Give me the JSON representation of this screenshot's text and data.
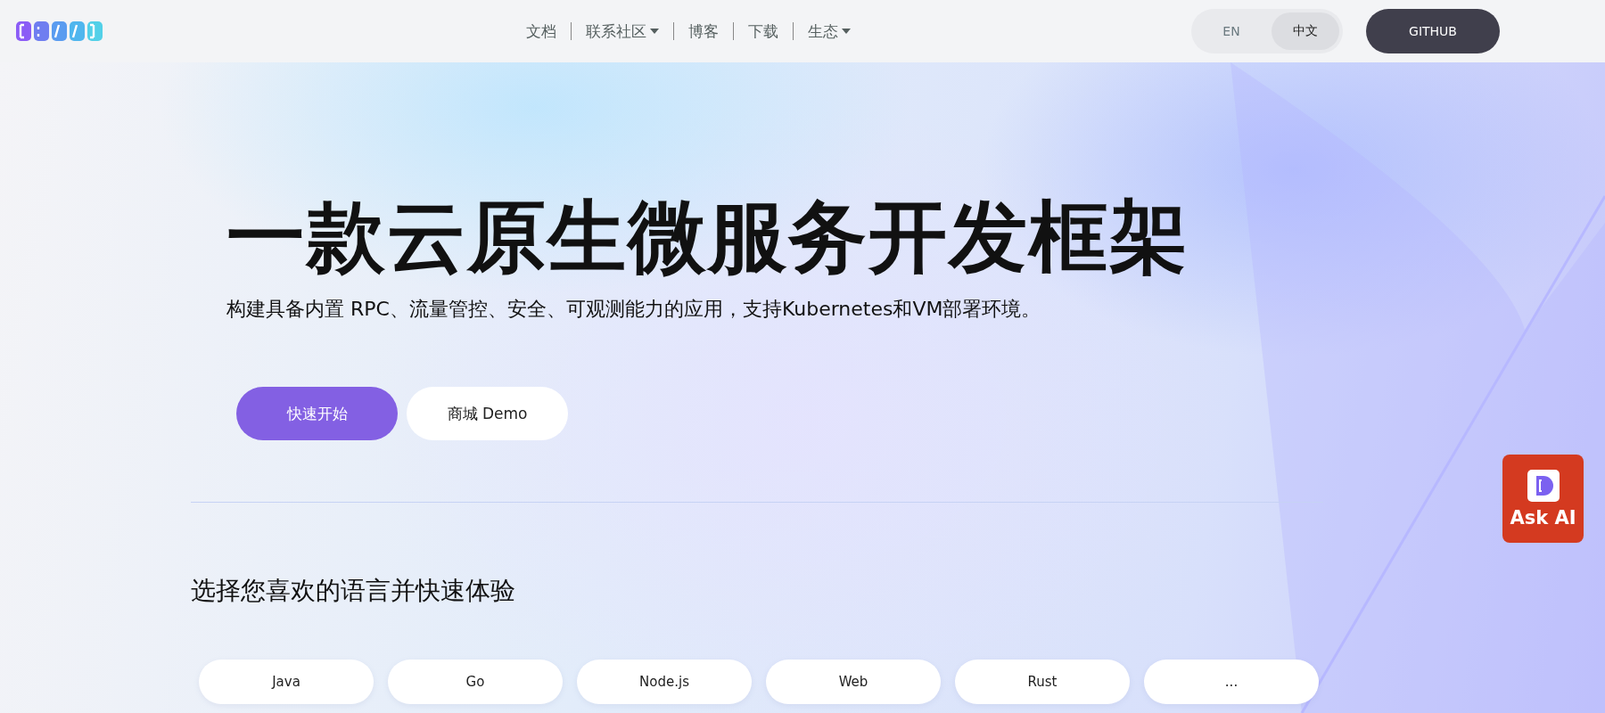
{
  "header": {
    "nav": [
      {
        "label": "文档",
        "dropdown": false
      },
      {
        "label": "联系社区",
        "dropdown": true
      },
      {
        "label": "博客",
        "dropdown": false
      },
      {
        "label": "下载",
        "dropdown": false
      },
      {
        "label": "生态",
        "dropdown": true
      }
    ],
    "languages": [
      {
        "label": "EN",
        "selected": false
      },
      {
        "label": "中文",
        "selected": true
      }
    ],
    "github_button": "GITHUB"
  },
  "hero": {
    "title": "一款云原生微服务开发框架",
    "subtitle": "构建具备内置 RPC、流量管控、安全、可观测能力的应用，支持Kubernetes和VM部署环境。",
    "buttons": [
      {
        "label": "快速开始",
        "kind": "primary"
      },
      {
        "label": "商城 Demo",
        "kind": "secondary"
      }
    ]
  },
  "languages_section": {
    "title": "选择您喜欢的语言并快速体验",
    "options": [
      "Java",
      "Go",
      "Node.js",
      "Web",
      "Rust",
      "..."
    ]
  },
  "ask_ai": {
    "label": "Ask AI"
  }
}
